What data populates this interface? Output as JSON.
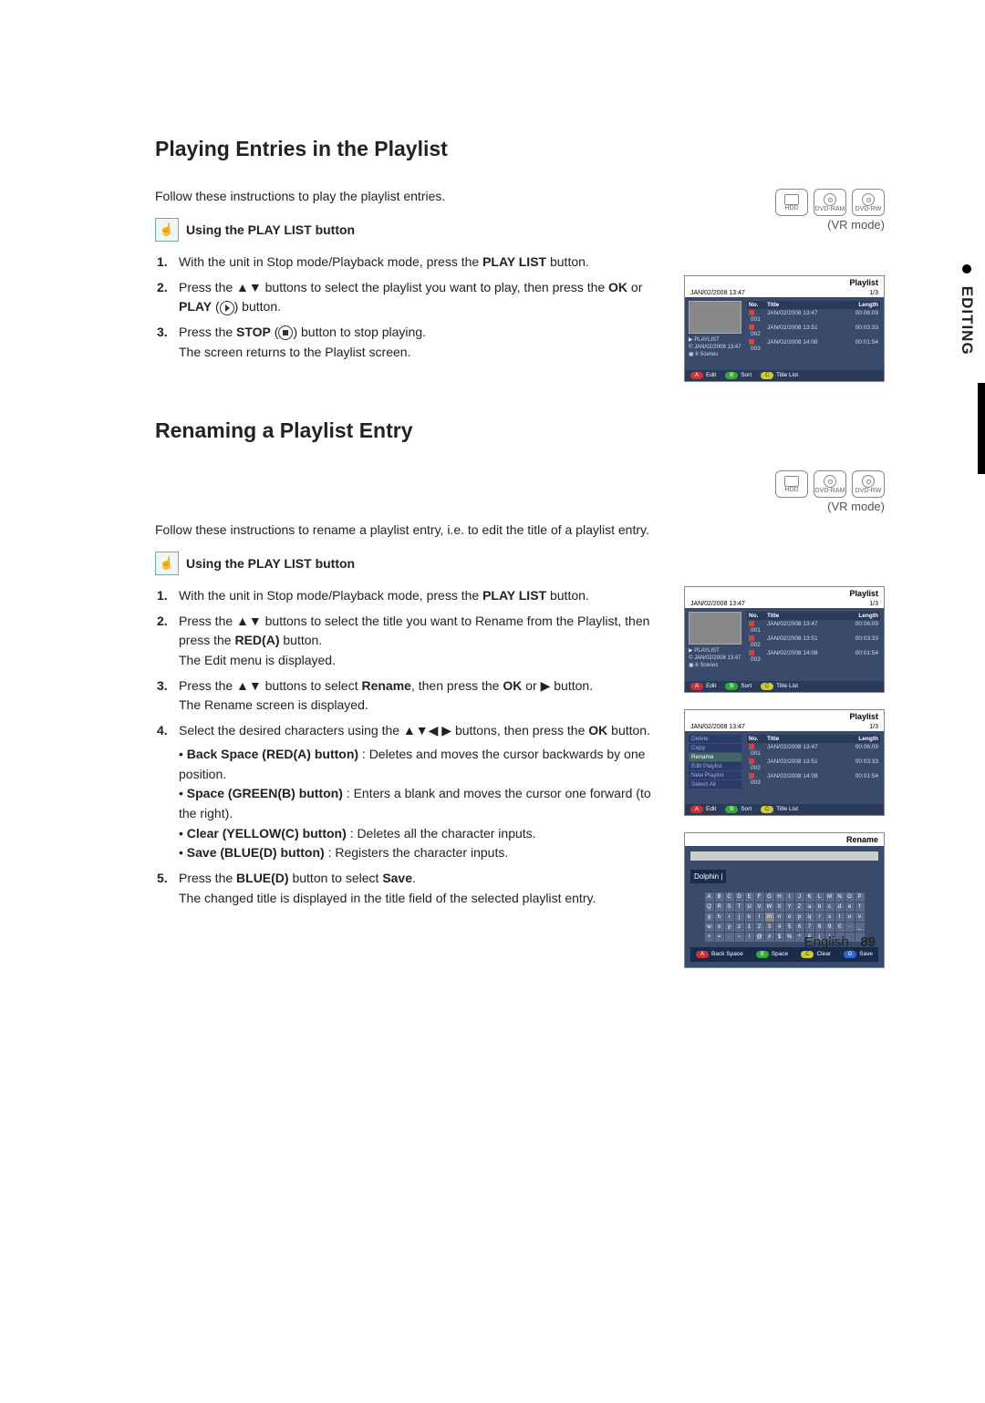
{
  "side_tab": "EDITING",
  "section1": {
    "title": "Playing Entries in the Playlist",
    "intro": "Follow these instructions to play the playlist entries.",
    "subhead": "Using the PLAY LIST button",
    "vr_mode": "(VR mode)",
    "media": [
      "HDD",
      "DVD-RAM",
      "DVD-RW"
    ],
    "steps": [
      "With the unit in Stop mode/Playback mode, press the PLAY LIST button.",
      "Press the ▲▼ buttons to select the playlist you want to play, then press the OK or PLAY (▶) button.",
      "Press the STOP (■) button to stop playing. The screen returns to the Playlist screen."
    ]
  },
  "section2": {
    "title": "Renaming a Playlist Entry",
    "intro": "Follow these instructions to rename a playlist entry, i.e. to edit the title of a playlist entry.",
    "subhead": "Using the PLAY LIST button",
    "vr_mode": "(VR mode)",
    "media": [
      "HDD",
      "DVD-RAM",
      "DVD-RW"
    ],
    "steps": [
      "With the unit in Stop mode/Playback mode, press the PLAY LIST button.",
      "Press the ▲▼ buttons to select the title you want to Rename from the Playlist, then press the RED(A) button. The Edit menu is displayed.",
      "Press the ▲▼ buttons to select Rename, then press the OK or ▶ button. The Rename screen is displayed.",
      "Select the desired characters using the ▲▼◀ ▶ buttons, then press the OK button.",
      "Press the BLUE(D) button to select Save. The changed title is displayed in the title field of the selected playlist entry."
    ],
    "bullets": [
      "Back Space (RED(A) button) : Deletes and moves the cursor backwards by one position.",
      "Space (GREEN(B) button) : Enters a blank and moves the cursor one forward (to the right).",
      "Clear (YELLOW(C) button) : Deletes all the character inputs.",
      "Save (BLUE(D) button) : Registers the character inputs."
    ]
  },
  "playlist_shot": {
    "title": "Playlist",
    "timestamp": "JAN/02/2008 13:47",
    "page": "1/3",
    "cols": {
      "no": "No.",
      "title": "Title",
      "len": "Length"
    },
    "rows": [
      {
        "no": "001",
        "title": "JAN/02/2008 13:47",
        "len": "00:06:09"
      },
      {
        "no": "002",
        "title": "JAN/02/2008 13:51",
        "len": "00:03:33"
      },
      {
        "no": "003",
        "title": "JAN/02/2008 14:08",
        "len": "00:01:54"
      }
    ],
    "left_info": [
      "▶ PLAYLIST",
      "© JAN/02/2008 13:47",
      "▣ 6 Scenes"
    ],
    "foot": {
      "a": "Edit",
      "b": "Sort",
      "c": "Title List"
    }
  },
  "edit_menu": [
    "Delete",
    "Copy",
    "Rename",
    "Edit Playlist",
    "New Playlist",
    "Select All"
  ],
  "rename_shot": {
    "title": "Rename",
    "field": "Dolphin |",
    "keyboards": [
      [
        "A",
        "B",
        "C",
        "D",
        "E",
        "F",
        "G",
        "H",
        "I",
        "J",
        "K",
        "L",
        "M",
        "N",
        "O",
        "P"
      ],
      [
        "Q",
        "R",
        "S",
        "T",
        "U",
        "V",
        "W",
        "X",
        "Y",
        "Z",
        "a",
        "b",
        "c",
        "d",
        "e",
        "f"
      ],
      [
        "g",
        "h",
        "i",
        "j",
        "k",
        "l",
        "m",
        "n",
        "o",
        "p",
        "q",
        "r",
        "s",
        "t",
        "u",
        "v"
      ],
      [
        "w",
        "x",
        "y",
        "z",
        "1",
        "2",
        "3",
        "4",
        "5",
        "6",
        "7",
        "8",
        "9",
        "0",
        "-",
        "_"
      ],
      [
        "+",
        "=",
        ".",
        "~",
        "!",
        "@",
        "#",
        "$",
        "%",
        "^",
        "&",
        "(",
        ")",
        "",
        "",
        ""
      ]
    ],
    "foot": {
      "back": "Back Space",
      "space": "Space",
      "clear": "Clear",
      "save": "Save"
    }
  },
  "footer": {
    "lang": "English",
    "page": "89"
  }
}
